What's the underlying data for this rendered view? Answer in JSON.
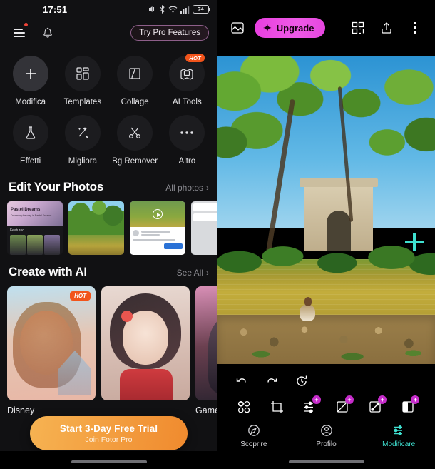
{
  "left": {
    "status": {
      "time": "17:51",
      "battery_level": "74",
      "icons": [
        "mute-icon",
        "bluetooth-icon",
        "wifi-icon",
        "cellular-signal-icon",
        "battery-icon"
      ]
    },
    "appbar": {
      "menu_icon": "hamburger-menu-icon",
      "bell_icon": "notification-bell-icon",
      "pro_button": "Try Pro Features"
    },
    "tools": [
      {
        "label": "Modifica",
        "icon": "plus-icon",
        "badge": ""
      },
      {
        "label": "Templates",
        "icon": "templates-icon",
        "badge": ""
      },
      {
        "label": "Collage",
        "icon": "collage-icon",
        "badge": ""
      },
      {
        "label": "AI Tools",
        "icon": "ai-tools-icon",
        "badge": "HOT"
      },
      {
        "label": "Effetti",
        "icon": "flask-effects-icon",
        "badge": ""
      },
      {
        "label": "Migliora",
        "icon": "magic-wand-icon",
        "badge": ""
      },
      {
        "label": "Bg Remover",
        "icon": "scissors-icon",
        "badge": ""
      },
      {
        "label": "Altro",
        "icon": "more-dots-icon",
        "badge": ""
      }
    ],
    "edit_photos": {
      "title": "Edit Your Photos",
      "link": "All photos",
      "chevron": "›",
      "thumbs": [
        {
          "name": "thumb-pastel-dreams",
          "caption": "Pastel Dreams",
          "sub": "Featured"
        },
        {
          "name": "thumb-park-nature"
        },
        {
          "name": "thumb-social-post"
        },
        {
          "name": "thumb-light-screenshot"
        }
      ]
    },
    "create_ai": {
      "title": "Create with AI",
      "link": "See All",
      "chevron": "›",
      "cards": [
        {
          "label": "Disney",
          "badge": "HOT"
        },
        {
          "label": "",
          "badge": ""
        },
        {
          "label": "Game C",
          "badge": ""
        }
      ]
    },
    "cta": {
      "title": "Start 3-Day Free Trial",
      "subtitle": "Join Fotor Pro"
    }
  },
  "right": {
    "topbar": {
      "gallery_icon": "image-gallery-icon",
      "upgrade_label": "Upgrade",
      "upgrade_icon": "sparkle-icon",
      "qr_icon": "qr-code-icon",
      "share_icon": "share-upload-icon",
      "more_icon": "kebab-menu-icon",
      "upgrade_color": "#e83fe0"
    },
    "canvas": {
      "overlay_icon": "add-plus-overlay-icon",
      "overlay_color": "#3fe0d0"
    },
    "history": [
      {
        "name": "undo-button",
        "icon": "undo-icon"
      },
      {
        "name": "redo-button",
        "icon": "redo-icon"
      },
      {
        "name": "reset-button",
        "icon": "reset-history-icon"
      }
    ],
    "edit_tools": [
      {
        "label": "Filtri",
        "icon": "filters-icon",
        "pro": ""
      },
      {
        "label": "Trasforma",
        "icon": "transform-icon",
        "pro": ""
      },
      {
        "label": "Regola",
        "icon": "adjust-icon",
        "pro": "+"
      },
      {
        "label": "Strati",
        "icon": "layers-icon",
        "pro": "+"
      },
      {
        "label": "Sfumature",
        "icon": "gradient-icon",
        "pro": "+"
      },
      {
        "label": "Bicromia",
        "icon": "duotone-icon",
        "pro": "+"
      }
    ],
    "nav": [
      {
        "label": "Scoprire",
        "icon": "compass-icon",
        "active": false
      },
      {
        "label": "Profilo",
        "icon": "person-icon",
        "active": false
      },
      {
        "label": "Modificare",
        "icon": "sliders-icon",
        "active": true
      }
    ],
    "active_color": "#3fe0d0"
  }
}
